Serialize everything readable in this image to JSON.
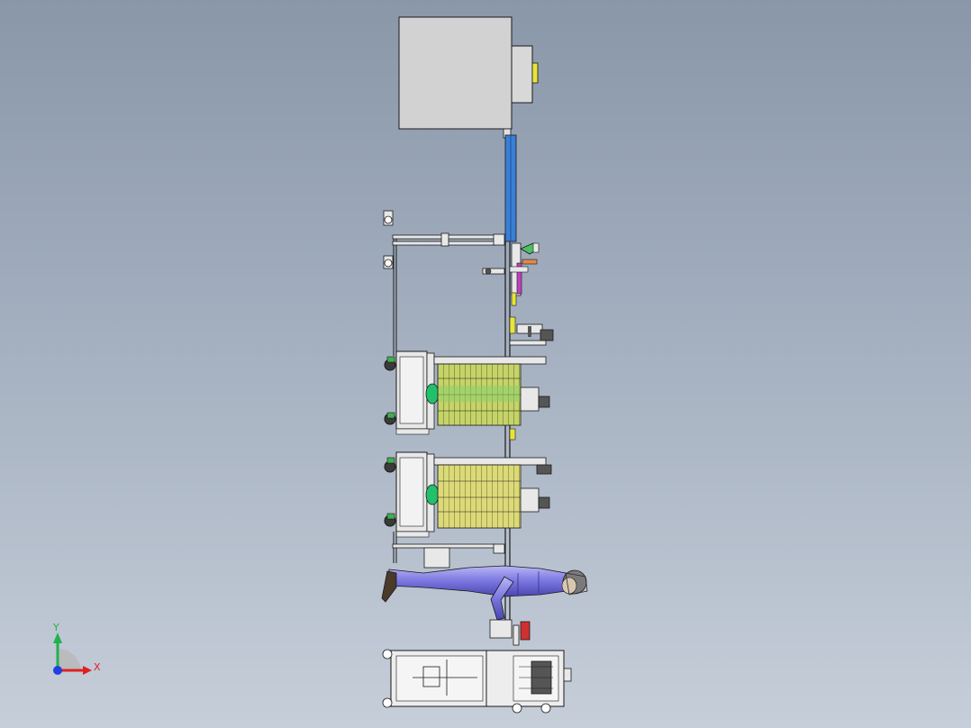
{
  "viewport": {
    "background_top": "#8a97a9",
    "background_bottom": "#c6ced9"
  },
  "triad": {
    "y_label": "Y",
    "x_label": "X",
    "y_color": "#22b14c",
    "x_color": "#e02020",
    "z_color": "#2040e0"
  },
  "colors": {
    "line": "#1a1a1a",
    "enclosure": "#d2d2d2",
    "conveyor": "#3a7fd6",
    "yellow": "#e8e43a",
    "green": "#22c06a",
    "olive": "#b9c25a",
    "figure": "#7a76e0",
    "magenta": "#c040c0",
    "orange": "#e08a4a",
    "red": "#d03030"
  }
}
